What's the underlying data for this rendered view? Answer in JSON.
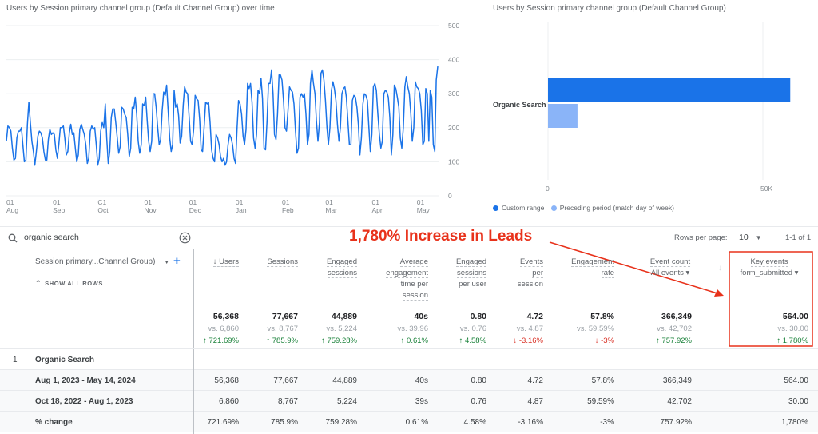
{
  "chart_data": [
    {
      "type": "line",
      "title": "Users by Session primary channel group (Default Channel Group) over time",
      "xlabel": "",
      "ylabel": "",
      "ylim": [
        0,
        500
      ],
      "yticks": [
        "500",
        "400",
        "300",
        "200",
        "100",
        "0"
      ],
      "y_tick_values": [
        500,
        400,
        300,
        200,
        100,
        0
      ],
      "x_tick_labels": [
        {
          "day": "01",
          "month": "Aug"
        },
        {
          "day": "01",
          "month": "Sep"
        },
        {
          "day": "C1",
          "month": "Oct"
        },
        {
          "day": "01",
          "month": "Nov"
        },
        {
          "day": "01",
          "month": "Dec"
        },
        {
          "day": "01",
          "month": "Jan"
        },
        {
          "day": "01",
          "month": "Feb"
        },
        {
          "day": "01",
          "month": "Mar"
        },
        {
          "day": "01",
          "month": "Apr"
        },
        {
          "day": "01",
          "month": "May"
        }
      ],
      "x_tick_day_index": [
        0,
        31,
        61,
        92,
        122,
        153,
        184,
        213,
        244,
        274
      ],
      "grid": true,
      "series": [
        {
          "name": "Organic Search (Custom range)",
          "color": "#1a73e8",
          "weekly_pattern_note": "daily users, weekly seasonality",
          "values": [
            160,
            205,
            200,
            190,
            140,
            105,
            110,
            170,
            190,
            190,
            200,
            150,
            100,
            105,
            210,
            275,
            215,
            160,
            130,
            90,
            130,
            175,
            190,
            185,
            170,
            130,
            105,
            105,
            165,
            195,
            180,
            185,
            180,
            135,
            110,
            150,
            200,
            200,
            205,
            170,
            120,
            130,
            185,
            210,
            180,
            185,
            140,
            100,
            120,
            195,
            210,
            195,
            180,
            150,
            95,
            110,
            190,
            205,
            195,
            200,
            150,
            90,
            110,
            190,
            215,
            200,
            270,
            170,
            95,
            130,
            230,
            255,
            255,
            215,
            170,
            125,
            145,
            260,
            255,
            240,
            230,
            180,
            115,
            140,
            260,
            255,
            290,
            240,
            160,
            125,
            150,
            270,
            265,
            290,
            220,
            160,
            130,
            160,
            300,
            300,
            260,
            200,
            150,
            165,
            250,
            305,
            295,
            325,
            250,
            170,
            130,
            150,
            310,
            260,
            270,
            235,
            155,
            175,
            265,
            320,
            305,
            300,
            230,
            160,
            150,
            195,
            295,
            285,
            280,
            225,
            135,
            130,
            200,
            275,
            270,
            275,
            215,
            135,
            110,
            100,
            180,
            170,
            150,
            115,
            100,
            110,
            90,
            100,
            150,
            180,
            170,
            150,
            110,
            95,
            200,
            280,
            270,
            240,
            175,
            150,
            195,
            330,
            315,
            330,
            275,
            170,
            140,
            180,
            310,
            300,
            345,
            285,
            140,
            135,
            220,
            330,
            330,
            370,
            300,
            180,
            165,
            240,
            355,
            355,
            340,
            280,
            200,
            190,
            250,
            320,
            310,
            305,
            270,
            190,
            125,
            140,
            290,
            300,
            290,
            300,
            240,
            150,
            180,
            330,
            370,
            330,
            300,
            220,
            160,
            215,
            360,
            370,
            340,
            280,
            200,
            150,
            200,
            310,
            335,
            315,
            280,
            210,
            160,
            200,
            300,
            315,
            320,
            290,
            220,
            150,
            150,
            280,
            295,
            290,
            260,
            210,
            120,
            170,
            270,
            300,
            295,
            280,
            200,
            130,
            180,
            320,
            330,
            310,
            240,
            180,
            140,
            160,
            300,
            310,
            305,
            290,
            230,
            120,
            180,
            325,
            315,
            290,
            260,
            170,
            140,
            200,
            320,
            350,
            320,
            300,
            240,
            160,
            200,
            335,
            320,
            315,
            300,
            250,
            150,
            160,
            315,
            300,
            160,
            310,
            290,
            150,
            130,
            340,
            380
          ]
        }
      ]
    },
    {
      "type": "bar",
      "orientation": "horizontal",
      "title": "Users by Session primary channel group (Default Channel Group)",
      "categories": [
        "Organic Search"
      ],
      "series": [
        {
          "name": "Custom range",
          "color": "#1a73e8",
          "values": [
            56368
          ]
        },
        {
          "name": "Preceding period (match day of week)",
          "color": "#8ab4f8",
          "values": [
            6860
          ]
        }
      ],
      "xlim": [
        0,
        56368
      ],
      "xticks": [
        "0",
        "50K"
      ],
      "x_tick_values": [
        0,
        50000
      ],
      "grid": true,
      "legend": "bottom-left"
    }
  ],
  "search": {
    "value": "organic search",
    "icon": "search-icon",
    "clear_icon": "clear-circle-icon"
  },
  "annotation": {
    "text": "1,780% Increase in Leads",
    "color": "#e8321b"
  },
  "pagination": {
    "rows_per_page_label": "Rows per page:",
    "rows_per_page_value": "10",
    "range_text": "1-1 of 1"
  },
  "table": {
    "dimension_header": "Session primary...Channel Group)",
    "show_all_rows": "SHOW ALL ROWS",
    "columns": [
      {
        "label": [
          "↓ Users"
        ],
        "total": "56,368",
        "vs": "vs. 6,860",
        "change": "↑ 721.69%",
        "dir": "up"
      },
      {
        "label": [
          "Sessions"
        ],
        "total": "77,667",
        "vs": "vs. 8,767",
        "change": "↑ 785.9%",
        "dir": "up"
      },
      {
        "label": [
          "Engaged",
          "sessions"
        ],
        "total": "44,889",
        "vs": "vs. 5,224",
        "change": "↑ 759.28%",
        "dir": "up"
      },
      {
        "label": [
          "Average",
          "engagement",
          "time per",
          "session"
        ],
        "total": "40s",
        "vs": "vs. 39.96",
        "change": "↑ 0.61%",
        "dir": "up"
      },
      {
        "label": [
          "Engaged",
          "sessions",
          "per user"
        ],
        "total": "0.80",
        "vs": "vs. 0.76",
        "change": "↑ 4.58%",
        "dir": "up"
      },
      {
        "label": [
          "Events",
          "per",
          "session"
        ],
        "total": "4.72",
        "vs": "vs. 4.87",
        "change": "↓ -3.16%",
        "dir": "down"
      },
      {
        "label": [
          "Engagement",
          "rate"
        ],
        "total": "57.8%",
        "vs": "vs. 59.59%",
        "change": "↓ -3%",
        "dir": "down"
      },
      {
        "label": [
          "Event count",
          "All events ▾"
        ],
        "total": "366,349",
        "vs": "vs. 42,702",
        "change": "↑ 757.92%",
        "dir": "up"
      },
      {
        "label": [
          "Key events",
          "form_submitted ▾"
        ],
        "total": "564.00",
        "vs": "vs. 30.00",
        "change": "↑ 1,780%",
        "dir": "up"
      }
    ],
    "rows": [
      {
        "index": "1",
        "label": "Organic Search",
        "cells": [
          "",
          "",
          "",
          "",
          "",
          "",
          "",
          "",
          ""
        ]
      },
      {
        "index": "",
        "label": "Aug 1, 2023 - May 14, 2024",
        "cells": [
          "56,368",
          "77,667",
          "44,889",
          "40s",
          "0.80",
          "4.72",
          "57.8%",
          "366,349",
          "564.00"
        ]
      },
      {
        "index": "",
        "label": "Oct 18, 2022 - Aug 1, 2023",
        "cells": [
          "6,860",
          "8,767",
          "5,224",
          "39s",
          "0.76",
          "4.87",
          "59.59%",
          "42,702",
          "30.00"
        ]
      },
      {
        "index": "",
        "label": "% change",
        "cells": [
          "721.69%",
          "785.9%",
          "759.28%",
          "0.61%",
          "4.58%",
          "-3.16%",
          "-3%",
          "757.92%",
          "1,780%"
        ]
      }
    ]
  }
}
